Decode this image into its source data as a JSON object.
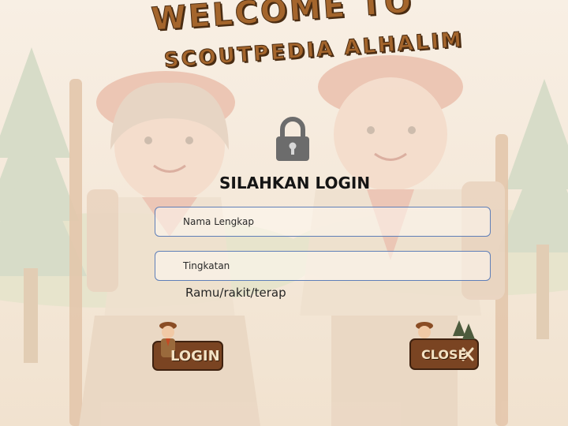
{
  "title": {
    "line1": "WELCOME TO",
    "line2": "SCOUTPEDIA ALHALIM"
  },
  "heading": "SILAHKAN LOGIN",
  "fields": {
    "nama": "Nama Lengkap",
    "tingkatan": "Tingkatan"
  },
  "hint": "Ramu/rakit/terap",
  "buttons": {
    "login": "LOGIN",
    "close": "CLOSE"
  },
  "colors": {
    "background": "#f6ece0",
    "title_fill": "#a4652c",
    "button_wood": "#7a4422",
    "field_border": "#5f7fb8"
  },
  "icons": {
    "lock": "padlock-icon",
    "close": "x-icon",
    "tree": "pine-tree-icon"
  }
}
